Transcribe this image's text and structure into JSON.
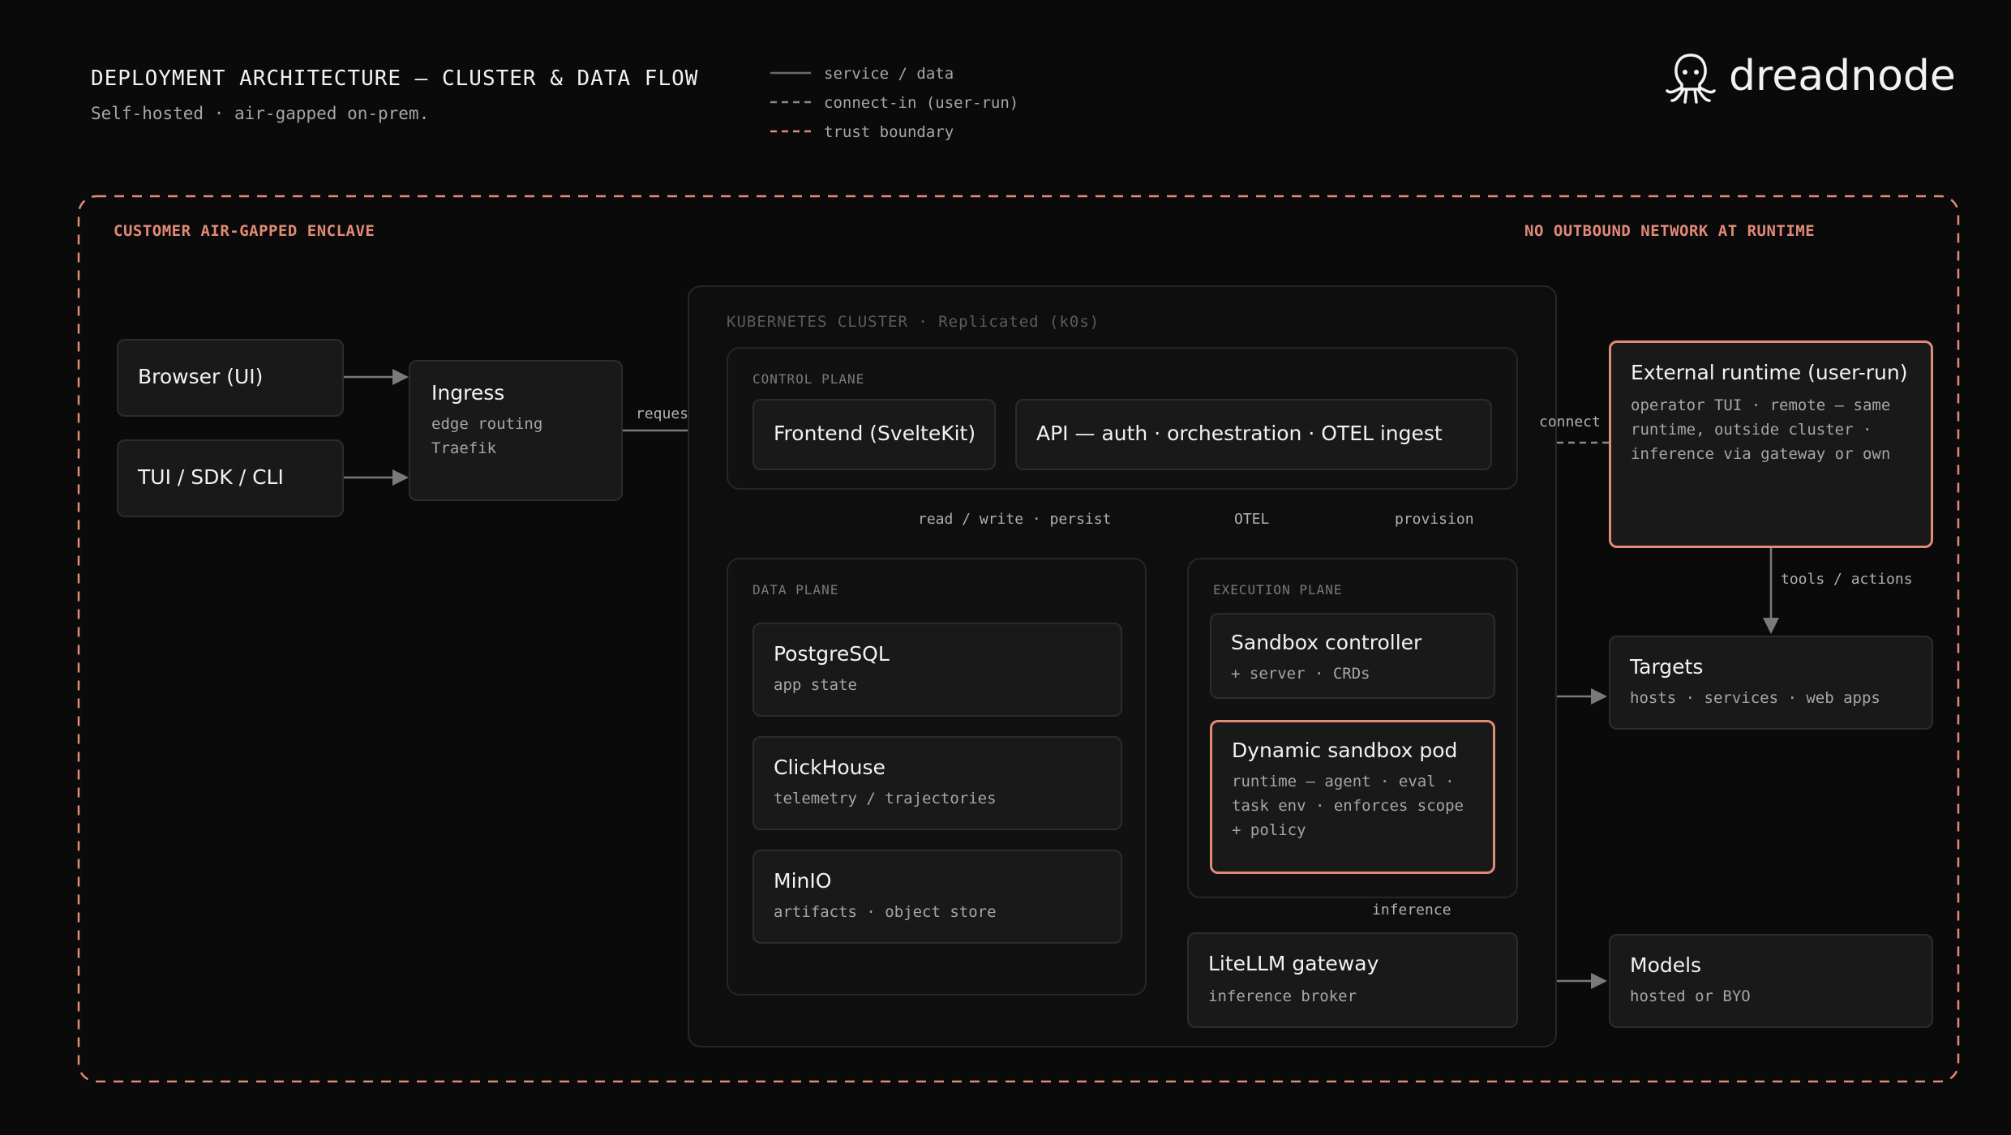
{
  "header": {
    "title": "DEPLOYMENT ARCHITECTURE — CLUSTER & DATA FLOW",
    "subtitle": "Self-hosted · air-gapped on-prem."
  },
  "legend": {
    "items": [
      {
        "label": "service / data",
        "style": "solid",
        "color": "#6a6a6a"
      },
      {
        "label": "connect-in (user-run)",
        "style": "dashed",
        "color": "#8a8a8a"
      },
      {
        "label": "trust boundary",
        "style": "dashed",
        "color": "#e28a78"
      }
    ]
  },
  "logo": {
    "text": "dreadnode",
    "icon": "octopus-logo-icon"
  },
  "enclave": {
    "label": "CUSTOMER AIR-GAPPED ENCLAVE",
    "note": "NO OUTBOUND NETWORK AT RUNTIME"
  },
  "clients": {
    "browser": "Browser (UI)",
    "tui": "TUI / SDK / CLI"
  },
  "ingress": {
    "title": "Ingress",
    "sub": "edge routing\nTraefik"
  },
  "cluster": {
    "label": "KUBERNETES CLUSTER · Replicated (k0s)",
    "control_plane": {
      "label": "CONTROL PLANE",
      "frontend": "Frontend (SvelteKit)",
      "api": "API — auth · orchestration · OTEL ingest"
    },
    "data_plane": {
      "label": "DATA PLANE",
      "stores": [
        {
          "title": "PostgreSQL",
          "sub": "app state"
        },
        {
          "title": "ClickHouse",
          "sub": "telemetry / trajectories"
        },
        {
          "title": "MinIO",
          "sub": "artifacts · object store"
        }
      ]
    },
    "execution_plane": {
      "label": "EXECUTION PLANE",
      "controller": {
        "title": "Sandbox controller",
        "sub": "+ server · CRDs"
      },
      "pod": {
        "title": "Dynamic sandbox pod",
        "sub": "runtime — agent · eval ·\ntask env · enforces scope\n+ policy"
      }
    },
    "gateway": {
      "title": "LiteLLM gateway",
      "sub": "inference broker"
    }
  },
  "external_runtime": {
    "title": "External runtime (user-run)",
    "sub": "operator TUI · remote — same\nruntime, outside cluster ·\ninference via gateway or own"
  },
  "targets": {
    "title": "Targets",
    "sub": "hosts · services · web apps"
  },
  "models": {
    "title": "Models",
    "sub": "hosted or BYO"
  },
  "edges": {
    "requests": "requests",
    "connect": "connect",
    "read_write": "read / write · persist",
    "otel": "OTEL",
    "provision": "provision",
    "tools": "tools / actions",
    "inference": "inference"
  },
  "colors": {
    "background": "#0a0a0a",
    "box": "#191919",
    "border": "#2c2c2c",
    "accent": "#e28a78",
    "text": "#f2f2f2",
    "muted": "#a6a6a6"
  }
}
